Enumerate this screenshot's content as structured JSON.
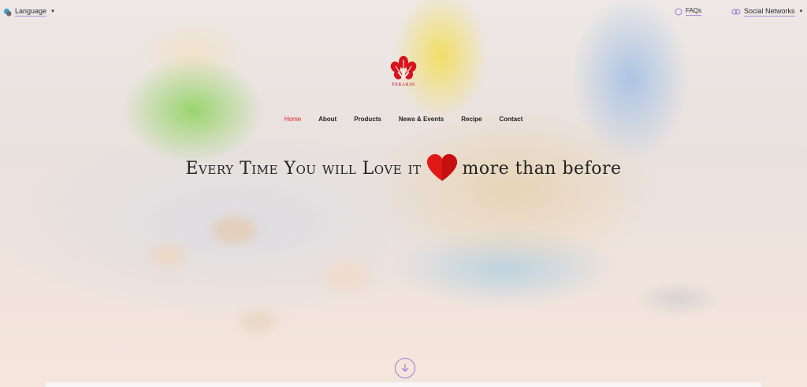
{
  "topbar": {
    "language_label": "Language",
    "faqs_label": "FAQs",
    "social_label": "Social Networks"
  },
  "logo": {
    "text": "PERARIN"
  },
  "nav": {
    "items": [
      {
        "label": "Home"
      },
      {
        "label": "About"
      },
      {
        "label": "Products"
      },
      {
        "label": "News & Events"
      },
      {
        "label": "Recipe"
      },
      {
        "label": "Contact"
      }
    ]
  },
  "hero": {
    "headline_part1": "Every Time You will Love it",
    "headline_part2": "more than before"
  },
  "colors": {
    "accent": "#e02020",
    "underline": "#b08be0",
    "scroll_circle": "#9b7bd6",
    "heart": "#e01818"
  },
  "icons": {
    "language": "language-icon",
    "faqs": "question-icon",
    "social": "social-icon",
    "heart": "heart-icon",
    "scroll": "arrow-down-icon"
  }
}
